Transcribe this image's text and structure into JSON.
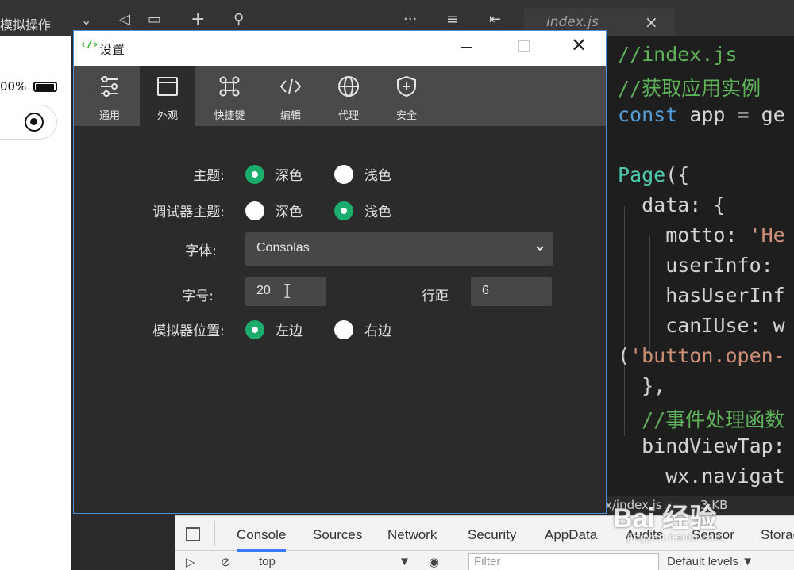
{
  "topbar": {
    "simulator_menu": "模拟操作",
    "editor_tab": "index.js"
  },
  "simulator": {
    "battery_pct": "00%"
  },
  "editor": {
    "lines": [
      {
        "text": "//index.js",
        "kind": "comment"
      },
      {
        "text": "//获取应用实例",
        "kind": "comment"
      },
      {
        "kw": "const",
        "rest": " app = ge"
      },
      {
        "text": "",
        "kind": "plain"
      },
      {
        "fn": "Page",
        "rest": "({"
      },
      {
        "text": "  data: {",
        "kind": "plain"
      },
      {
        "key": "    motto: ",
        "str": "'He"
      },
      {
        "text": "    userInfo:",
        "kind": "plain"
      },
      {
        "text": "    hasUserInf",
        "kind": "plain"
      },
      {
        "text": "    canIUse: w",
        "kind": "plain"
      },
      {
        "pre": "(",
        "str": "'button.open-"
      },
      {
        "text": "  },",
        "kind": "plain"
      },
      {
        "text": "  //事件处理函数",
        "kind": "comment"
      },
      {
        "text": "  bindViewTap:",
        "kind": "plain"
      },
      {
        "text": "    wx.navigat",
        "kind": "plain"
      }
    ],
    "status_path": "x/index.js",
    "status_size": "3 KB"
  },
  "devtools": {
    "tabs": [
      "Console",
      "Sources",
      "Network",
      "Security",
      "AppData",
      "Audits",
      "Sensor",
      "Storag"
    ],
    "active_tab": "Console",
    "context": "top",
    "filter_placeholder": "Filter",
    "levels": "Default levels ▼"
  },
  "dialog": {
    "title": "设置",
    "toolbar": [
      {
        "label": "通用",
        "icon": "sliders-icon"
      },
      {
        "label": "外观",
        "icon": "window-icon"
      },
      {
        "label": "快捷键",
        "icon": "command-key-icon"
      },
      {
        "label": "编辑",
        "icon": "code-icon"
      },
      {
        "label": "代理",
        "icon": "globe-icon"
      },
      {
        "label": "安全",
        "icon": "shield-icon"
      }
    ],
    "active_tool": "外观",
    "theme": {
      "label": "主题:",
      "option1": "深色",
      "option2": "浅色",
      "selected": "深色"
    },
    "debugger_theme": {
      "label": "调试器主题:",
      "option1": "深色",
      "option2": "浅色",
      "selected": "浅色"
    },
    "font": {
      "label": "字体:",
      "value": "Consolas"
    },
    "font_size": {
      "label": "字号:",
      "value": "20"
    },
    "line_height": {
      "label": "行距",
      "value": "6"
    },
    "simulator_position": {
      "label": "模拟器位置:",
      "option1": "左边",
      "option2": "右边",
      "selected": "左边"
    }
  },
  "watermark": {
    "brand": "Bai 经验",
    "url": "jingyan.baidu.com"
  },
  "colors": {
    "accent_green": "#1aad6b",
    "dialog_bg": "#2b2b2b",
    "toolbar_bg": "#4a4a4a",
    "code_comment": "#5fb25a",
    "code_keyword": "#569cd6"
  }
}
